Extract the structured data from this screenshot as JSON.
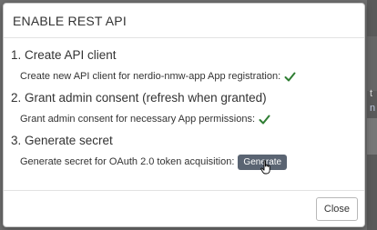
{
  "background": {
    "fragments": [
      "t",
      "n"
    ]
  },
  "dialog": {
    "title": "ENABLE REST API",
    "steps": [
      {
        "title": "1. Create API client",
        "text": "Create new API client for nerdio-nmw-app App registration:",
        "status_icon": "check-icon"
      },
      {
        "title": "2. Grant admin consent (refresh when granted)",
        "text": "Grant admin consent for necessary App permissions:",
        "status_icon": "check-icon"
      },
      {
        "title": "3. Generate secret",
        "text": "Generate secret for OAuth 2.0 token acquisition:",
        "button_label": "Generate"
      }
    ],
    "close_label": "Close"
  },
  "colors": {
    "check": "#2e7d32",
    "generate_button": "#5a6472",
    "backdrop": "#6f6f6f"
  }
}
